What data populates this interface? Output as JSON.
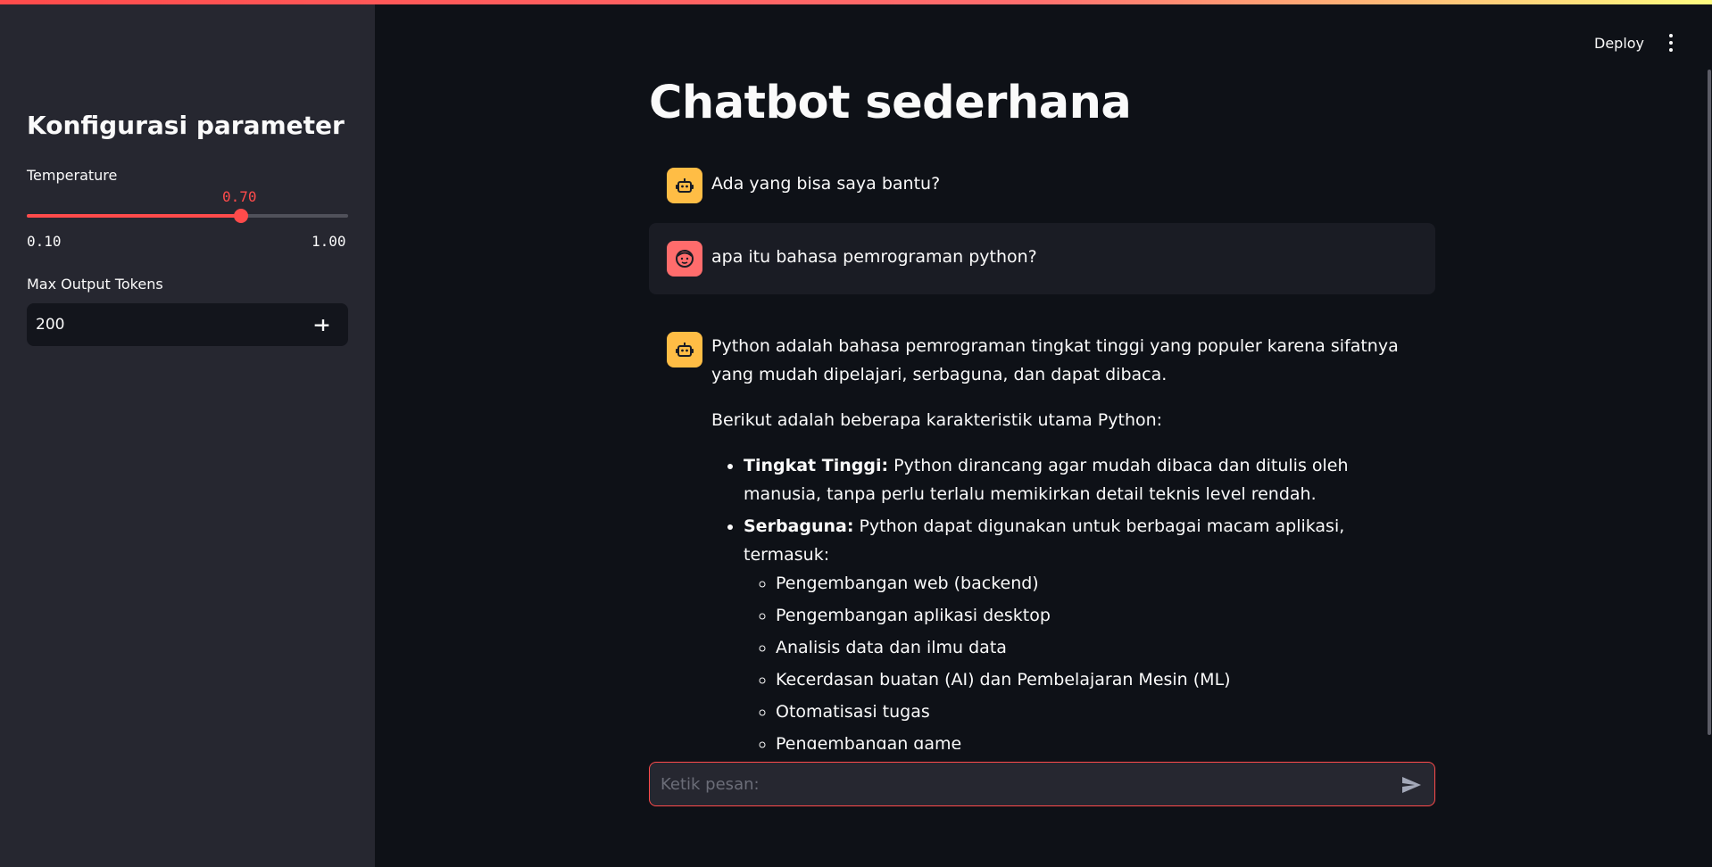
{
  "app": {
    "accent_color": "#ff4b4b",
    "toolbar": {
      "deploy_label": "Deploy",
      "menu_icon": "more-vertical-icon"
    }
  },
  "sidebar": {
    "title": "Konfigurasi parameter",
    "temperature": {
      "label": "Temperature",
      "value": "0.70",
      "min": "0.10",
      "max": "1.00",
      "fraction": 0.667
    },
    "max_tokens": {
      "label": "Max Output Tokens",
      "value": "200",
      "decrement": "−",
      "increment": "+"
    }
  },
  "main": {
    "title": "Chatbot sederhana",
    "messages": [
      {
        "role": "assistant",
        "avatar_icon": "robot-icon",
        "text": "Ada yang bisa saya bantu?"
      },
      {
        "role": "user",
        "avatar_icon": "user-face-icon",
        "text": "apa itu bahasa pemrograman python?"
      },
      {
        "role": "assistant",
        "avatar_icon": "robot-icon",
        "intro": "Python adalah bahasa pemrograman tingkat tinggi yang populer karena sifatnya yang mudah dipelajari, serbaguna, dan dapat dibaca.",
        "lead": "Berikut adalah beberapa karakteristik utama Python:",
        "points": [
          {
            "term": "Tingkat Tinggi:",
            "desc": " Python dirancang agar mudah dibaca dan ditulis oleh manusia, tanpa perlu terlalu memikirkan detail teknis level rendah."
          },
          {
            "term": "Serbaguna:",
            "desc": " Python dapat digunakan untuk berbagai macam aplikasi, termasuk:",
            "sub": [
              "Pengembangan web (backend)",
              "Pengembangan aplikasi desktop",
              "Analisis data dan ilmu data",
              "Kecerdasan buatan (AI) dan Pembelajaran Mesin (ML)",
              "Otomatisasi tugas",
              "Pengembangan game"
            ]
          }
        ]
      }
    ],
    "chat_input": {
      "placeholder": "Ketik pesan:",
      "send_icon": "send-icon"
    }
  }
}
